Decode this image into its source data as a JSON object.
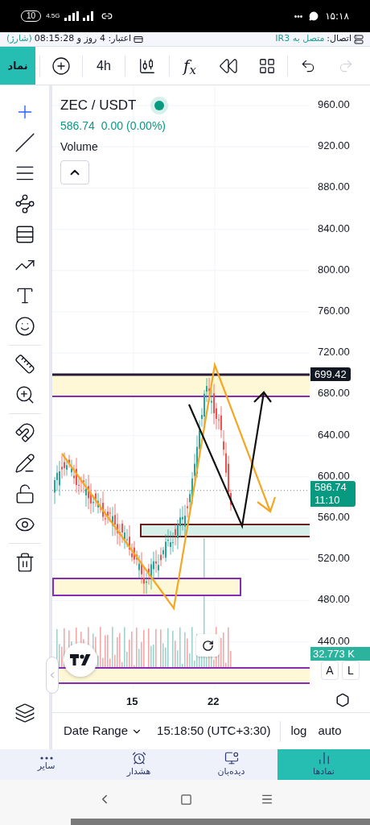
{
  "status_bar": {
    "battery": "10",
    "network": "4.5G",
    "more": "•••",
    "time": "۱۵:۱۸"
  },
  "info_bar": {
    "credit_label": "اعتبار: 4 روز و 08:15:28",
    "credit_action": "(شارژ)",
    "connection_label": "اتصال:",
    "connection_value": "متصل به IR3"
  },
  "toolbar": {
    "symbol_button": "نماد",
    "interval": "4h",
    "indicators": "f$_{x}$",
    "redo_disabled": true
  },
  "drawing_tools": [
    {
      "selected": true
    },
    {
      "selected": false
    },
    {
      "selected": false
    },
    {
      "selected": false
    },
    {
      "selected": false
    },
    {
      "selected": false
    },
    {
      "selected": false
    },
    {
      "selected": false
    },
    {
      "selected": false
    },
    {
      "selected": false
    },
    {
      "selected": false
    },
    {
      "selected": false
    },
    {
      "selected": false
    },
    {
      "selected": false
    },
    {
      "selected": false
    }
  ],
  "chart": {
    "symbol": "ZEC / USDT",
    "last_price": "586.74",
    "change": "0.00 (0.00%)",
    "indicator": "Volume",
    "price_axis": [
      "960.00",
      "920.00",
      "880.00",
      "840.00",
      "800.00",
      "760.00",
      "720.00",
      "680.00",
      "640.00",
      "600.00",
      "560.00",
      "520.00",
      "480.00",
      "440.00"
    ],
    "price_tag": "699.42",
    "last_price_tag": "586.74",
    "countdown": "11:10",
    "volume_tag": "32.773 K",
    "scale_buttons": [
      "A",
      "L"
    ],
    "date_axis": [
      "15",
      "22"
    ]
  },
  "footer": {
    "range": "Date Range",
    "time": "15:18:50 (UTC+3:30)",
    "log": "log",
    "auto": "auto"
  },
  "bottom_nav": [
    {
      "label": "نمادها",
      "selected": true
    },
    {
      "label": "دیده‌بان",
      "selected": false
    },
    {
      "label": "هشدار",
      "selected": false
    },
    {
      "label": "سایر",
      "selected": false
    }
  ]
}
